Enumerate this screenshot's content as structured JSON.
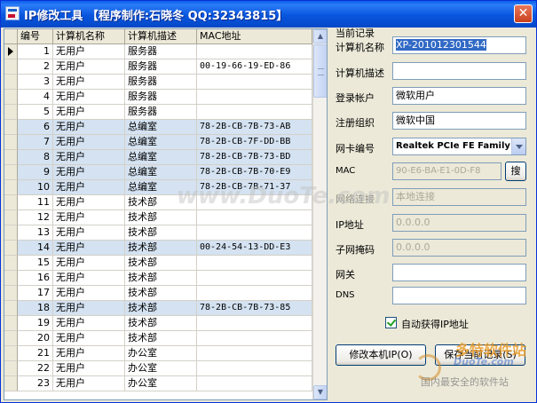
{
  "window": {
    "title": "IP修改工具 【程序制作:石晓冬 QQ:32343815】",
    "close_label": "✕",
    "icon": "app-icon"
  },
  "table": {
    "headers": [
      "编号",
      "计算机名称",
      "计算机描述",
      "MAC地址"
    ],
    "rows": [
      {
        "id": "1",
        "name": "无用户",
        "desc": "服务器",
        "mac": "",
        "highlight": false,
        "current": true
      },
      {
        "id": "2",
        "name": "无用户",
        "desc": "服务器",
        "mac": "00-19-66-19-ED-86",
        "highlight": false
      },
      {
        "id": "3",
        "name": "无用户",
        "desc": "服务器",
        "mac": "",
        "highlight": false
      },
      {
        "id": "4",
        "name": "无用户",
        "desc": "服务器",
        "mac": "",
        "highlight": false
      },
      {
        "id": "5",
        "name": "无用户",
        "desc": "服务器",
        "mac": "",
        "highlight": false
      },
      {
        "id": "6",
        "name": "无用户",
        "desc": "总编室",
        "mac": "78-2B-CB-7B-73-AB",
        "highlight": true
      },
      {
        "id": "7",
        "name": "无用户",
        "desc": "总编室",
        "mac": "78-2B-CB-7F-DD-BB",
        "highlight": true
      },
      {
        "id": "8",
        "name": "无用户",
        "desc": "总编室",
        "mac": "78-2B-CB-7B-73-BD",
        "highlight": true
      },
      {
        "id": "9",
        "name": "无用户",
        "desc": "总编室",
        "mac": "78-2B-CB-7B-70-E9",
        "highlight": true
      },
      {
        "id": "10",
        "name": "无用户",
        "desc": "总编室",
        "mac": "78-2B-CB-7B-71-37",
        "highlight": true
      },
      {
        "id": "11",
        "name": "无用户",
        "desc": "技术部",
        "mac": "",
        "highlight": false
      },
      {
        "id": "12",
        "name": "无用户",
        "desc": "技术部",
        "mac": "",
        "highlight": false
      },
      {
        "id": "13",
        "name": "无用户",
        "desc": "技术部",
        "mac": "",
        "highlight": false
      },
      {
        "id": "14",
        "name": "无用户",
        "desc": "技术部",
        "mac": "00-24-54-13-DD-E3",
        "highlight": true
      },
      {
        "id": "15",
        "name": "无用户",
        "desc": "技术部",
        "mac": "",
        "highlight": false
      },
      {
        "id": "16",
        "name": "无用户",
        "desc": "技术部",
        "mac": "",
        "highlight": false
      },
      {
        "id": "17",
        "name": "无用户",
        "desc": "技术部",
        "mac": "",
        "highlight": false
      },
      {
        "id": "18",
        "name": "无用户",
        "desc": "技术部",
        "mac": "78-2B-CB-7B-73-85",
        "highlight": true
      },
      {
        "id": "19",
        "name": "无用户",
        "desc": "技术部",
        "mac": "",
        "highlight": false
      },
      {
        "id": "20",
        "name": "无用户",
        "desc": "技术部",
        "mac": "",
        "highlight": false
      },
      {
        "id": "21",
        "name": "无用户",
        "desc": "办公室",
        "mac": "",
        "highlight": false
      },
      {
        "id": "22",
        "name": "无用户",
        "desc": "办公室",
        "mac": "",
        "highlight": false
      },
      {
        "id": "23",
        "name": "无用户",
        "desc": "办公室",
        "mac": "",
        "highlight": false
      }
    ],
    "highlight_color": "#d4e2f1"
  },
  "record": {
    "group_title": "当前记录",
    "computer_name_label": "计算机名称",
    "computer_name_value": "XP-201012301544",
    "computer_desc_label": "计算机描述",
    "computer_desc_value": "",
    "login_label": "登录帐户",
    "login_value": "微软用户",
    "org_label": "注册组织",
    "org_value": "微软中国",
    "nic_label": "网卡编号",
    "nic_value": "Realtek PCIe FE Family",
    "mac_label": "MAC",
    "mac_value": "90-E6-BA-E1-0D-F8",
    "search_button": "搜",
    "conn_label": "网络连接",
    "conn_value": "本地连接",
    "ip_label": "IP地址",
    "ip_value": "0.0.0.0",
    "mask_label": "子网掩码",
    "mask_value": "0.0.0.0",
    "gateway_label": "网关",
    "gateway_value": "",
    "dns_label": "DNS",
    "dns_value": "",
    "auto_ip_label": "自动获得IP地址",
    "auto_ip_checked": true
  },
  "buttons": {
    "modify": "修改本机IP(O)",
    "save": "保存当前记录(S)"
  },
  "watermarks": {
    "center": "www.DuoTe.com",
    "brand": "多特软件站",
    "brand_url": "DuoTe.com",
    "tagline": "国内最安全的软件站"
  }
}
